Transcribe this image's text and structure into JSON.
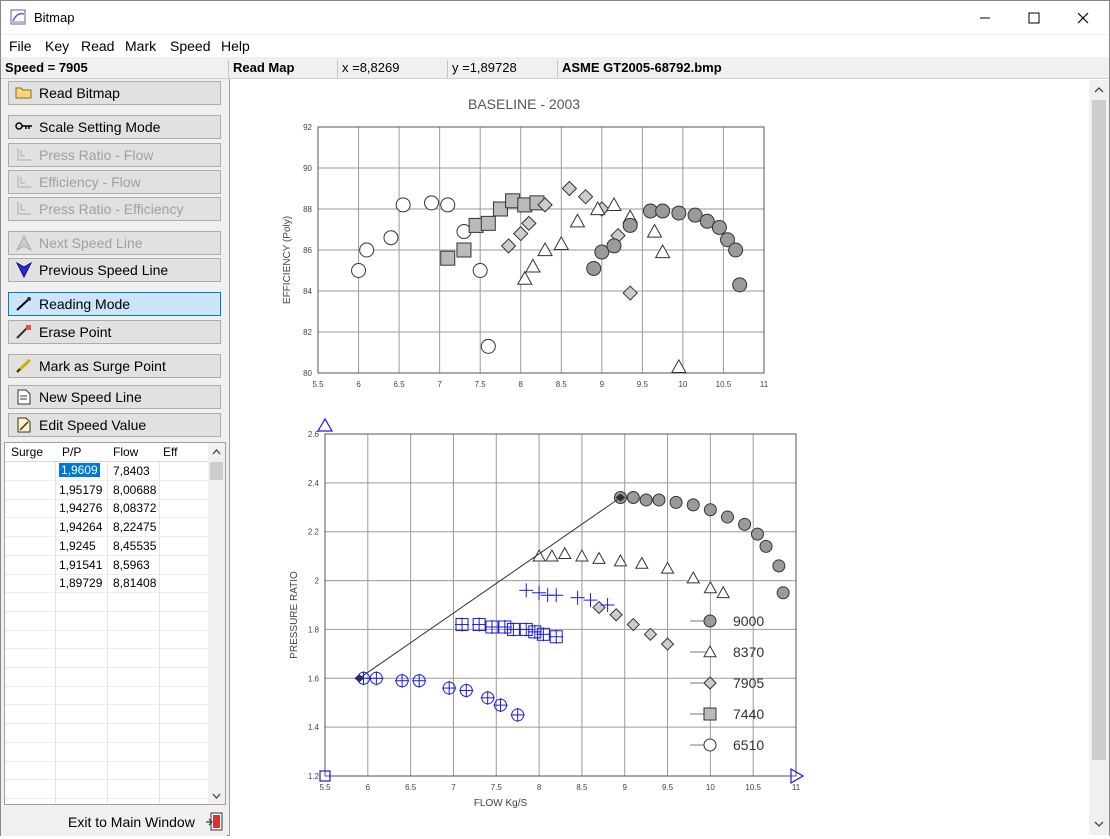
{
  "window": {
    "title": "Bitmap"
  },
  "menu": [
    "File",
    "Key",
    "Read",
    "Mark",
    "Speed",
    "Help"
  ],
  "status": {
    "speed": "Speed = 7905",
    "mode": "Read Map",
    "x": "x =8,8269",
    "y": "y =1,89728",
    "file": "ASME GT2005-68792.bmp"
  },
  "toolbar": {
    "read_bitmap": "Read Bitmap",
    "scale_setting": "Scale Setting Mode",
    "pr_flow": "Press Ratio - Flow",
    "eff_flow": "Efficiency - Flow",
    "pr_eff": "Press Ratio - Efficiency",
    "next_speed": "Next Speed Line",
    "prev_speed": "Previous Speed Line",
    "reading_mode": "Reading Mode",
    "erase_point": "Erase Point",
    "mark_surge": "Mark as Surge Point",
    "new_speed": "New Speed Line",
    "edit_speed": "Edit Speed Value"
  },
  "table": {
    "headers": [
      "Surge",
      "P/P",
      "Flow",
      "Eff"
    ],
    "rows": [
      [
        "",
        "1,9609",
        "7,8403",
        ""
      ],
      [
        "",
        "1,95179",
        "8,00688",
        ""
      ],
      [
        "",
        "1,94276",
        "8,08372",
        ""
      ],
      [
        "",
        "1,94264",
        "8,22475",
        ""
      ],
      [
        "",
        "1,9245",
        "8,45535",
        ""
      ],
      [
        "",
        "1,91541",
        "8,5963",
        ""
      ],
      [
        "",
        "1,89729",
        "8,81408",
        ""
      ]
    ]
  },
  "exit_label": "Exit to Main Window",
  "colors": {
    "accent": "#0078d7",
    "selection": "#0078d7",
    "marker_blue": "#1a1adc"
  },
  "chart_data": [
    {
      "type": "scatter",
      "title": "BASELINE - 2003",
      "xlabel": "",
      "ylabel": "EFFICIENCY (Poly)",
      "xlim": [
        5.5,
        11
      ],
      "ylim": [
        80,
        92
      ],
      "x_ticks": [
        "5.5",
        "6",
        "6.5",
        "7",
        "7.5",
        "8",
        "8.5",
        "9",
        "9.5",
        "10",
        "10.5",
        "11"
      ],
      "y_ticks": [
        "80",
        "82",
        "84",
        "86",
        "88",
        "90",
        "92"
      ],
      "series": [
        {
          "name": "6510",
          "values": [
            [
              6.0,
              85.0
            ],
            [
              6.1,
              86.0
            ],
            [
              6.4,
              86.6
            ],
            [
              6.55,
              88.2
            ],
            [
              6.9,
              88.3
            ],
            [
              7.1,
              88.2
            ],
            [
              7.3,
              86.9
            ],
            [
              7.5,
              85.0
            ],
            [
              7.6,
              81.3
            ]
          ]
        },
        {
          "name": "7440",
          "values": [
            [
              7.1,
              85.6
            ],
            [
              7.3,
              86.0
            ],
            [
              7.45,
              87.2
            ],
            [
              7.6,
              87.3
            ],
            [
              7.75,
              88.0
            ],
            [
              7.9,
              88.4
            ],
            [
              8.05,
              88.2
            ],
            [
              8.2,
              88.3
            ]
          ]
        },
        {
          "name": "7905",
          "values": [
            [
              7.85,
              86.2
            ],
            [
              8.0,
              86.8
            ],
            [
              8.1,
              87.3
            ],
            [
              8.3,
              88.2
            ],
            [
              8.6,
              89.0
            ],
            [
              8.8,
              88.6
            ],
            [
              9.0,
              88.0
            ],
            [
              9.2,
              86.7
            ],
            [
              9.35,
              83.9
            ]
          ]
        },
        {
          "name": "8370",
          "values": [
            [
              8.05,
              84.6
            ],
            [
              8.15,
              85.2
            ],
            [
              8.3,
              86.0
            ],
            [
              8.5,
              86.3
            ],
            [
              8.7,
              87.4
            ],
            [
              8.95,
              88.0
            ],
            [
              9.15,
              88.2
            ],
            [
              9.35,
              87.6
            ],
            [
              9.65,
              86.9
            ],
            [
              9.75,
              85.9
            ],
            [
              9.95,
              80.3
            ]
          ]
        },
        {
          "name": "9000",
          "values": [
            [
              8.9,
              85.1
            ],
            [
              9.0,
              85.9
            ],
            [
              9.15,
              86.2
            ],
            [
              9.35,
              87.2
            ],
            [
              9.6,
              87.9
            ],
            [
              9.75,
              87.9
            ],
            [
              9.95,
              87.8
            ],
            [
              10.15,
              87.7
            ],
            [
              10.3,
              87.4
            ],
            [
              10.45,
              87.1
            ],
            [
              10.55,
              86.5
            ],
            [
              10.65,
              86.0
            ],
            [
              10.7,
              84.3
            ]
          ]
        }
      ]
    },
    {
      "type": "scatter",
      "title": "",
      "xlabel": "FLOW Kg/S",
      "ylabel": "PRESSURE RATIO",
      "xlim": [
        5.5,
        11
      ],
      "ylim": [
        1.2,
        2.6
      ],
      "x_ticks": [
        "5.5",
        "6",
        "6.5",
        "7",
        "7.5",
        "8",
        "8.5",
        "9",
        "9.5",
        "10",
        "10.5",
        "11"
      ],
      "y_ticks": [
        "1.2",
        "1.4",
        "1.6",
        "1.8",
        "2",
        "2.2",
        "2.4",
        "2.6"
      ],
      "legend": [
        "9000",
        "8370",
        "7905",
        "7440",
        "6510"
      ],
      "legend_position": "right",
      "series": [
        {
          "name": "9000",
          "values": [
            [
              8.95,
              2.34
            ],
            [
              9.1,
              2.34
            ],
            [
              9.25,
              2.33
            ],
            [
              9.4,
              2.33
            ],
            [
              9.6,
              2.32
            ],
            [
              9.8,
              2.31
            ],
            [
              10.0,
              2.29
            ],
            [
              10.2,
              2.26
            ],
            [
              10.4,
              2.23
            ],
            [
              10.55,
              2.19
            ],
            [
              10.65,
              2.14
            ],
            [
              10.8,
              2.06
            ],
            [
              10.85,
              1.95
            ]
          ]
        },
        {
          "name": "8370",
          "values": [
            [
              8.0,
              2.1
            ],
            [
              8.15,
              2.1
            ],
            [
              8.3,
              2.11
            ],
            [
              8.5,
              2.1
            ],
            [
              8.7,
              2.09
            ],
            [
              8.95,
              2.08
            ],
            [
              9.2,
              2.07
            ],
            [
              9.5,
              2.05
            ],
            [
              9.8,
              2.01
            ],
            [
              10.0,
              1.97
            ],
            [
              10.15,
              1.95
            ]
          ]
        },
        {
          "name": "7905",
          "values": [
            [
              8.7,
              1.89
            ],
            [
              8.9,
              1.86
            ],
            [
              9.1,
              1.82
            ],
            [
              9.3,
              1.78
            ],
            [
              9.5,
              1.74
            ]
          ]
        },
        {
          "name": "6510",
          "values": []
        }
      ],
      "digitized_points": [
        {
          "line": "surge",
          "values": [
            [
              5.9,
              1.6
            ],
            [
              8.95,
              2.34
            ]
          ]
        },
        {
          "line": "7905",
          "values": [
            [
              7.85,
              1.96
            ],
            [
              8.0,
              1.95
            ],
            [
              8.1,
              1.94
            ],
            [
              8.2,
              1.94
            ],
            [
              8.45,
              1.93
            ],
            [
              8.6,
              1.92
            ],
            [
              8.8,
              1.9
            ]
          ]
        },
        {
          "line": "7440",
          "values": [
            [
              7.1,
              1.82
            ],
            [
              7.3,
              1.82
            ],
            [
              7.45,
              1.81
            ],
            [
              7.6,
              1.81
            ],
            [
              7.7,
              1.8
            ],
            [
              7.85,
              1.8
            ],
            [
              7.95,
              1.79
            ],
            [
              8.05,
              1.78
            ],
            [
              8.2,
              1.77
            ]
          ]
        },
        {
          "line": "6510",
          "values": [
            [
              5.95,
              1.6
            ],
            [
              6.1,
              1.6
            ],
            [
              6.4,
              1.59
            ],
            [
              6.6,
              1.59
            ],
            [
              6.95,
              1.56
            ],
            [
              7.15,
              1.55
            ],
            [
              7.4,
              1.52
            ],
            [
              7.55,
              1.49
            ],
            [
              7.75,
              1.45
            ]
          ]
        }
      ]
    }
  ]
}
